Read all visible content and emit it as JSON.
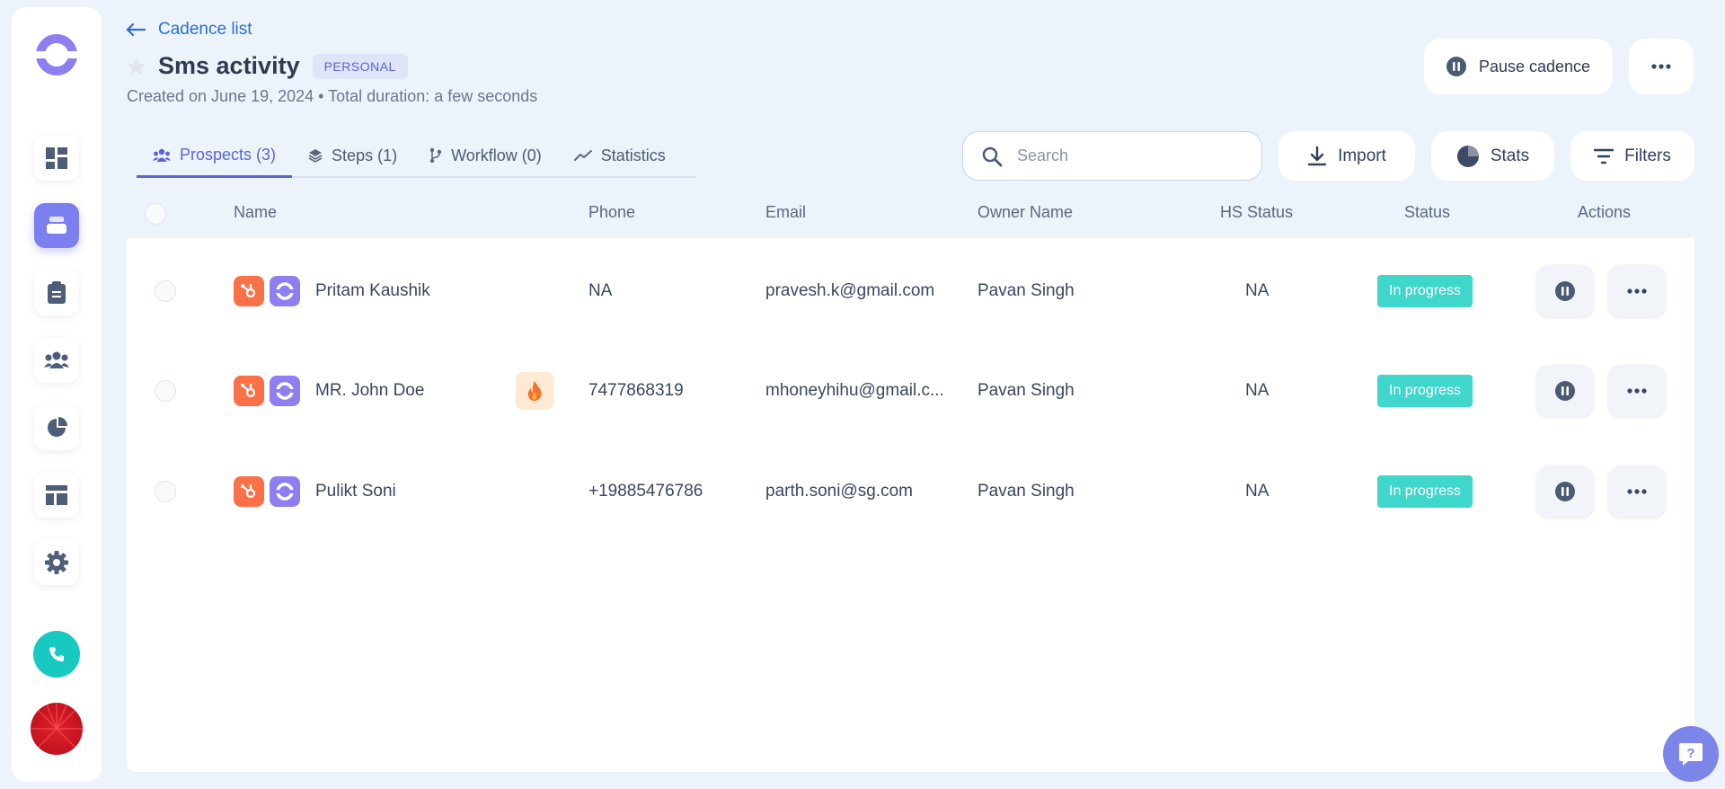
{
  "nav": {
    "back_label": "Cadence list"
  },
  "cadence": {
    "title": "Sms activity",
    "badge": "PERSONAL",
    "meta": "Created on June 19, 2024 • Total duration: a few seconds"
  },
  "header_actions": {
    "pause_label": "Pause cadence"
  },
  "tabs": [
    {
      "label": "Prospects (3)",
      "icon": "users-icon",
      "active": true
    },
    {
      "label": "Steps (1)",
      "icon": "layers-icon",
      "active": false
    },
    {
      "label": "Workflow (0)",
      "icon": "workflow-icon",
      "active": false
    },
    {
      "label": "Statistics",
      "icon": "trend-icon",
      "active": false
    }
  ],
  "toolbar": {
    "search_placeholder": "Search",
    "import_label": "Import",
    "stats_label": "Stats",
    "filters_label": "Filters"
  },
  "table": {
    "columns": {
      "name": "Name",
      "phone": "Phone",
      "email": "Email",
      "owner": "Owner Name",
      "hs_status": "HS Status",
      "status": "Status",
      "actions": "Actions"
    },
    "rows": [
      {
        "name": "Pritam Kaushik",
        "hot": false,
        "phone": "NA",
        "email": "pravesh.k@gmail.com",
        "owner": "Pavan Singh",
        "hs_status": "NA",
        "status": "In progress"
      },
      {
        "name": "MR. John Doe",
        "hot": true,
        "phone": "7477868319",
        "email": "mhoneyhihu@gmail.c...",
        "owner": "Pavan Singh",
        "hs_status": "NA",
        "status": "In progress"
      },
      {
        "name": "Pulikt Soni",
        "hot": false,
        "phone": "+19885476786",
        "email": "parth.soni@sg.com",
        "owner": "Pavan Singh",
        "hs_status": "NA",
        "status": "In progress"
      }
    ]
  },
  "colors": {
    "accent": "#5b63d6",
    "sidebar_active": "#7b7ff0",
    "status_in_progress": "#3fd6cc",
    "hubspot": "#fa7147",
    "call": "#17c9c0"
  }
}
